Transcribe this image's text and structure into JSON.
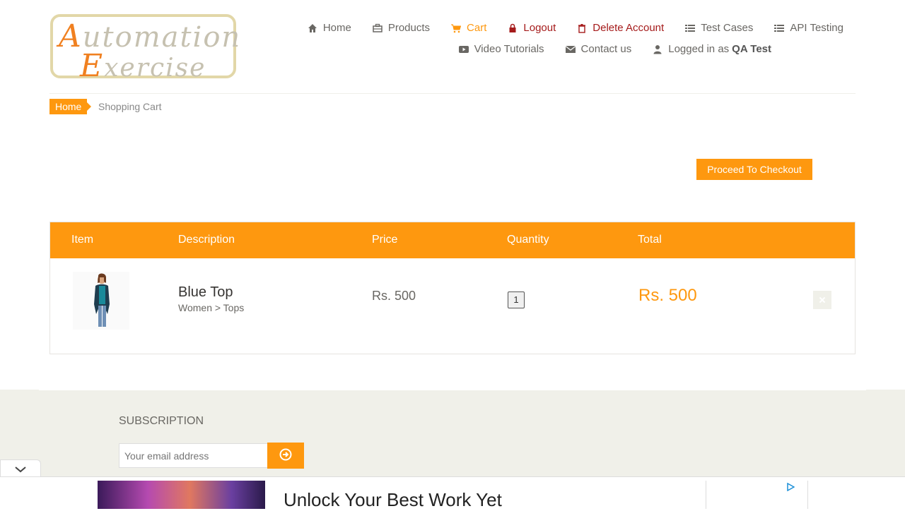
{
  "brand": {
    "line1": "Automation",
    "line2": "Exercise"
  },
  "nav": {
    "row1": [
      {
        "label": "Home",
        "icon": "home-icon"
      },
      {
        "label": "Products",
        "icon": "products-icon"
      },
      {
        "label": "Cart",
        "icon": "cart-icon",
        "state": "active"
      },
      {
        "label": "Logout",
        "icon": "lock-icon"
      },
      {
        "label": "Delete Account",
        "icon": "trash-icon"
      },
      {
        "label": "Test Cases",
        "icon": "list-icon"
      },
      {
        "label": "API Testing",
        "icon": "list-icon"
      }
    ],
    "row2": [
      {
        "label": "Video Tutorials",
        "icon": "youtube-icon"
      },
      {
        "label": "Contact us",
        "icon": "envelope-icon"
      },
      {
        "label": "Logged in as",
        "user": "QA Test",
        "icon": "user-icon"
      }
    ]
  },
  "breadcrumb": {
    "home": "Home",
    "current": "Shopping Cart"
  },
  "checkout": {
    "label": "Proceed To Checkout"
  },
  "cart": {
    "headers": [
      "Item",
      "Description",
      "Price",
      "Quantity",
      "Total"
    ],
    "rows": [
      {
        "name": "Blue Top",
        "category": "Women > Tops",
        "price": "Rs. 500",
        "quantity": "1",
        "total": "Rs. 500"
      }
    ]
  },
  "footer": {
    "subscription_title": "SUBSCRIPTION",
    "email_placeholder": "Your email address"
  },
  "ad": {
    "headline": "Unlock Your Best Work Yet"
  },
  "colors": {
    "accent": "#FE980F",
    "footer_bg": "#F0F0E9",
    "danger": "#a51b1b"
  }
}
